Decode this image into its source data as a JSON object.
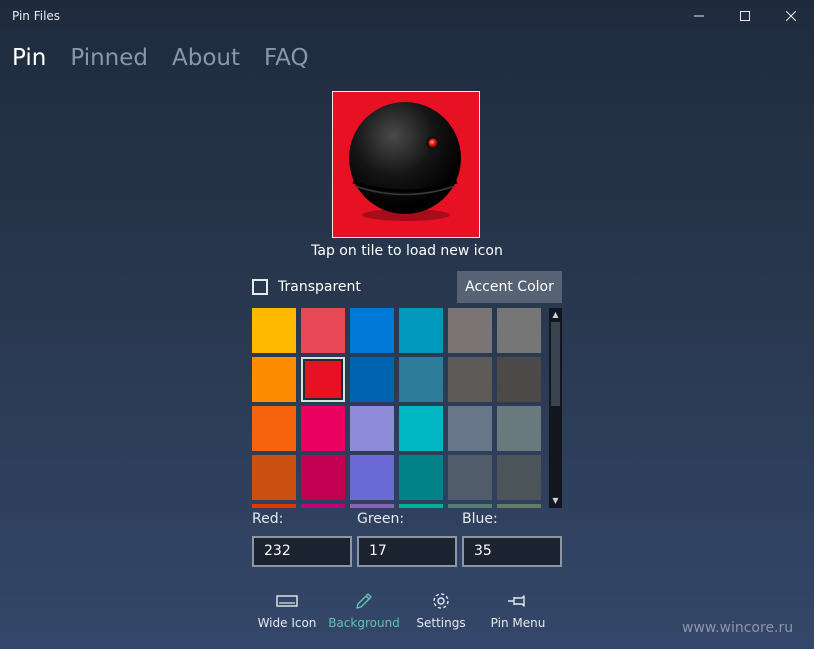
{
  "window": {
    "title": "Pin Files"
  },
  "nav": {
    "tabs": [
      "Pin",
      "Pinned",
      "About",
      "FAQ"
    ],
    "active": 0
  },
  "tile": {
    "background": "#e81123",
    "hint": "Tap on tile to load new icon",
    "icon": "black-sphere-icon"
  },
  "transparent": {
    "label": "Transparent",
    "checked": false
  },
  "accent_button": {
    "label": "Accent Color"
  },
  "palette": {
    "rows": [
      [
        "#ffb900",
        "#e74856",
        "#0078d7",
        "#0099bc",
        "#7a7574",
        "#767676"
      ],
      [
        "#ff8c00",
        "#e81123",
        "#0063b1",
        "#2d7d9a",
        "#5d5a58",
        "#4c4a48"
      ],
      [
        "#f7630c",
        "#ea005e",
        "#8e8cd8",
        "#00b7c3",
        "#68768a",
        "#69797e"
      ],
      [
        "#ca5010",
        "#c30052",
        "#6b69d6",
        "#038387",
        "#515c6b",
        "#4a5459"
      ],
      [
        "#da3b01",
        "#bf0077",
        "#8764b8",
        "#00b294",
        "#567c73",
        "#647c64"
      ]
    ],
    "selected": [
      1,
      1
    ]
  },
  "rgb": {
    "red_label": "Red:",
    "green_label": "Green:",
    "blue_label": "Blue:",
    "red": "232",
    "green": "17",
    "blue": "35"
  },
  "commands": [
    {
      "label": "Wide Icon",
      "icon": "wide-tile-icon"
    },
    {
      "label": "Background",
      "icon": "pencil-icon",
      "active": true
    },
    {
      "label": "Settings",
      "icon": "gear-icon"
    },
    {
      "label": "Pin Menu",
      "icon": "pin-icon"
    }
  ],
  "watermark": "www.wincore.ru",
  "colors": {
    "accent_teal": "#5fc3b2",
    "selection_border": "#cfe3d8"
  }
}
